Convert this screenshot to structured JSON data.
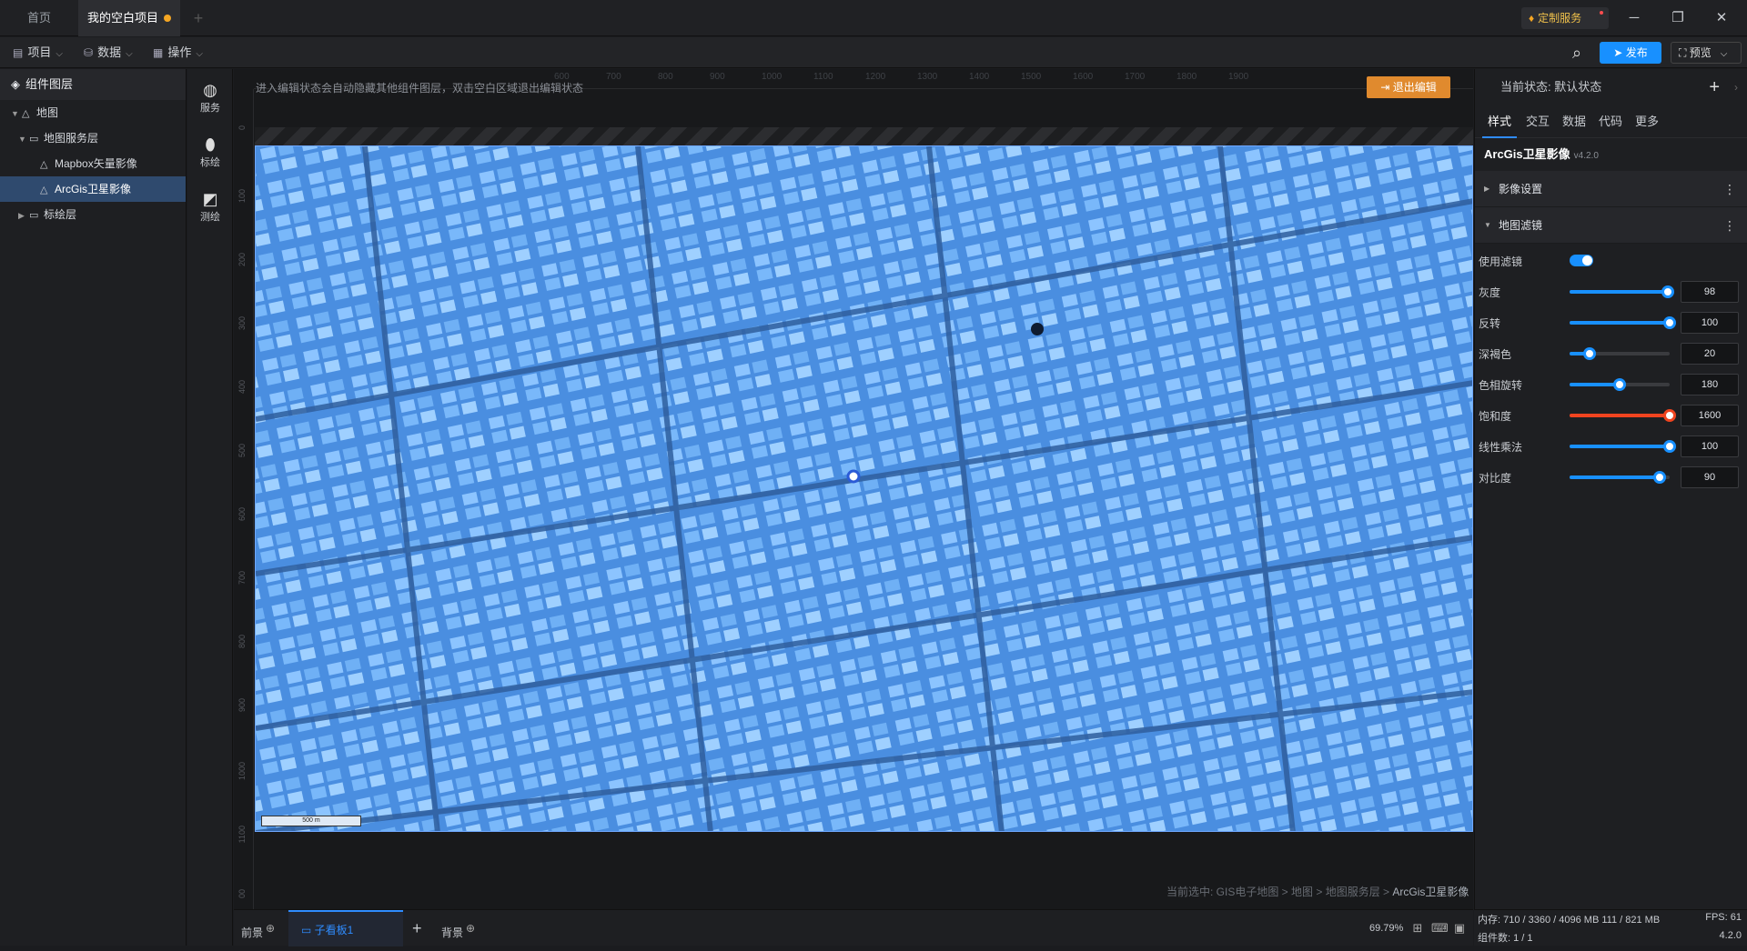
{
  "titlebar": {
    "tabs": [
      {
        "label": "首页"
      },
      {
        "label": "我的空白项目"
      }
    ],
    "add_tab": "+",
    "custom_service": "定制服务",
    "minimize": "─",
    "restore": "❐",
    "close": "✕"
  },
  "toolbar": {
    "menus": [
      {
        "label": "项目"
      },
      {
        "label": "数据"
      },
      {
        "label": "操作"
      }
    ],
    "publish": "发布",
    "preview": "预览"
  },
  "layers": {
    "title": "组件图层",
    "items": [
      {
        "label": "地图"
      },
      {
        "label": "地图服务层"
      },
      {
        "label": "Mapbox矢量影像"
      },
      {
        "label": "ArcGis卫星影像"
      },
      {
        "label": "标绘层"
      }
    ]
  },
  "rail": {
    "items": [
      {
        "label": "服务"
      },
      {
        "label": "标绘"
      },
      {
        "label": "测绘"
      }
    ]
  },
  "canvas": {
    "hint": "进入编辑状态会自动隐藏其他组件图层，双击空白区域退出编辑状态",
    "exit_edit": "退出编辑",
    "ruler_top": [
      "600",
      "700",
      "800",
      "900",
      "1000",
      "1100",
      "1200",
      "1300",
      "1400",
      "1500",
      "1600",
      "1700",
      "1800",
      "1900"
    ],
    "ruler_left": [
      "0",
      "100",
      "200",
      "300",
      "400",
      "500",
      "600",
      "700",
      "800",
      "900",
      "1000",
      "1100",
      "00"
    ],
    "scale_label": "500 m",
    "selected_prefix": "当前选中: GIS电子地图 > 地图 > 地图服务层 > ",
    "selected_last": "ArcGis卫星影像"
  },
  "bottom": {
    "tabs": [
      {
        "label": "前景"
      },
      {
        "label": "子看板1"
      },
      {
        "label": "背景"
      }
    ],
    "add": "+",
    "zoom": "69.79%"
  },
  "panel": {
    "state_label": "当前状态:  默认状态",
    "tabs": [
      {
        "label": "样式"
      },
      {
        "label": "交互"
      },
      {
        "label": "数据"
      },
      {
        "label": "代码"
      },
      {
        "label": "更多"
      }
    ],
    "component_name": "ArcGis卫星影像",
    "component_version": "v4.2.0",
    "sections": [
      {
        "label": "影像设置"
      },
      {
        "label": "地图滤镜"
      }
    ],
    "filter_toggle_label": "使用滤镜",
    "filter_enabled": true,
    "controls": [
      {
        "label": "灰度",
        "value": "98",
        "fill": 0.98,
        "color": "#1890ff"
      },
      {
        "label": "反转",
        "value": "100",
        "fill": 1.0,
        "color": "#1890ff"
      },
      {
        "label": "深褐色",
        "value": "20",
        "fill": 0.2,
        "color": "#1890ff"
      },
      {
        "label": "色相旋转",
        "value": "180",
        "fill": 0.5,
        "color": "#1890ff"
      },
      {
        "label": "饱和度",
        "value": "1600",
        "fill": 1.0,
        "color": "#f0441f"
      },
      {
        "label": "线性乘法",
        "value": "100",
        "fill": 1.0,
        "color": "#1890ff"
      },
      {
        "label": "对比度",
        "value": "90",
        "fill": 0.9,
        "color": "#1890ff"
      }
    ]
  },
  "status": {
    "memory": "内存:  710 / 3360 / 4096 MB  111 / 821 MB",
    "fps": "FPS:  61",
    "component_count": "组件数: 1 / 1",
    "version": "4.2.0"
  }
}
